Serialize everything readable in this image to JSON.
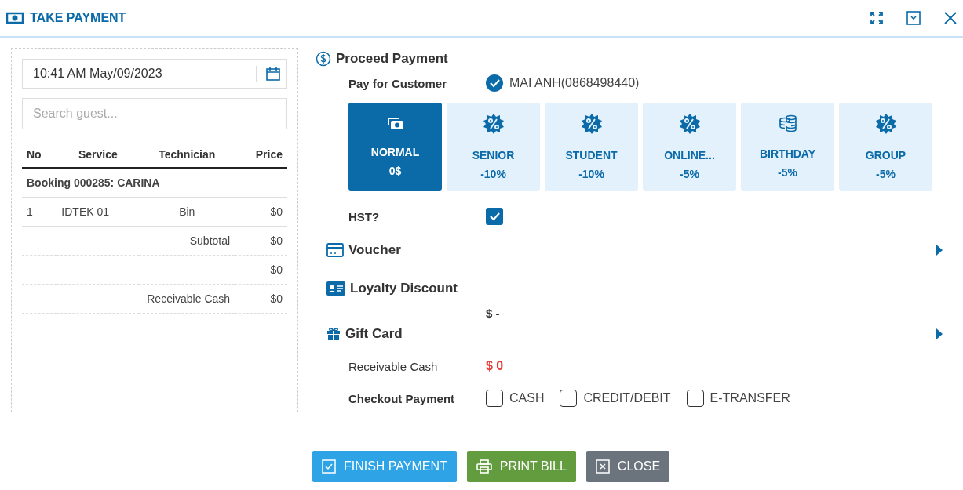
{
  "window": {
    "title": "TAKE PAYMENT"
  },
  "left": {
    "datetime": "10:41 AM May/09/2023",
    "search": {
      "placeholder": "Search guest..."
    },
    "columns": [
      "No",
      "Service",
      "Technician",
      "Price"
    ],
    "booking": "Booking 000285: CARINA",
    "rows": [
      {
        "no": "1",
        "service": "IDTEK 01",
        "technician": "Bin",
        "price": "$0"
      }
    ],
    "summary": [
      {
        "label": "Subtotal",
        "value": "$0"
      },
      {
        "value": "$0"
      },
      {
        "label": "Receivable Cash",
        "value": "$0"
      }
    ]
  },
  "payment": {
    "title": "Proceed Payment",
    "customer_label": "Pay for Customer",
    "customer": {
      "name": "MAI ANH(0868498440)",
      "checked": true
    },
    "discounts": [
      {
        "kind": "cash",
        "name": "NORMAL",
        "value": "0$",
        "selected": true
      },
      {
        "kind": "percent",
        "name": "SENIOR",
        "value": "-10%",
        "selected": false
      },
      {
        "kind": "percent",
        "name": "STUDENT",
        "value": "-10%",
        "selected": false
      },
      {
        "kind": "percent",
        "name": "ONLINE...",
        "value": "-5%",
        "selected": false
      },
      {
        "kind": "coins",
        "name": "BIRTHDAY",
        "value": "-5%",
        "selected": false
      },
      {
        "kind": "percent",
        "name": "GROUP",
        "value": "-5%",
        "selected": false
      }
    ],
    "hst": {
      "label": "HST?",
      "checked": true
    },
    "voucher": "Voucher",
    "loyalty": "Loyalty Discount",
    "loyalty_value": "$ -",
    "gift_card": "Gift Card",
    "receivable_label": "Receivable Cash",
    "receivable_value": "$ 0",
    "checkout_label": "Checkout Payment",
    "methods": [
      {
        "label": "CASH",
        "checked": false
      },
      {
        "label": "CREDIT/DEBIT",
        "checked": false
      },
      {
        "label": "E-TRANSFER",
        "checked": false
      }
    ]
  },
  "buttons": [
    {
      "kind": "finish",
      "label": "FINISH PAYMENT"
    },
    {
      "kind": "print",
      "label": "PRINT BILL"
    },
    {
      "kind": "close",
      "label": "CLOSE"
    }
  ]
}
